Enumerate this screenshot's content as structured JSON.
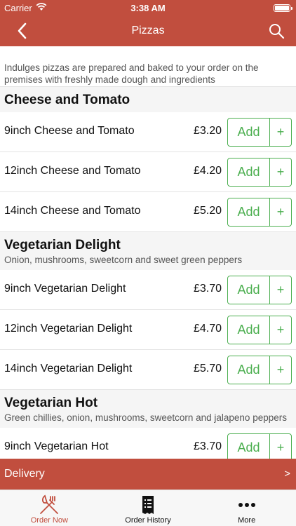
{
  "status": {
    "carrier": "Carrier",
    "time": "3:38 AM"
  },
  "navbar": {
    "title": "Pizzas",
    "back_icon": "chevron-left-icon",
    "search_icon": "search-icon"
  },
  "intro": "Indulges pizzas are prepared and baked to your order on the premises with freshly made dough and ingredients",
  "add_label": "Add",
  "plus_label": "+",
  "sections": [
    {
      "title": "Cheese and Tomato",
      "description": "",
      "items": [
        {
          "name": "9inch Cheese and Tomato",
          "price": "£3.20"
        },
        {
          "name": "12inch Cheese and Tomato",
          "price": "£4.20"
        },
        {
          "name": "14inch Cheese and Tomato",
          "price": "£5.20"
        }
      ]
    },
    {
      "title": "Vegetarian Delight",
      "description": "Onion, mushrooms, sweetcorn and sweet green peppers",
      "items": [
        {
          "name": "9inch Vegetarian Delight",
          "price": "£3.70"
        },
        {
          "name": "12inch Vegetarian Delight",
          "price": "£4.70"
        },
        {
          "name": "14inch Vegetarian Delight",
          "price": "£5.70"
        }
      ]
    },
    {
      "title": "Vegetarian Hot",
      "description": "Green chillies, onion, mushrooms, sweetcorn and jalapeno peppers",
      "items": [
        {
          "name": "9inch Vegetarian Hot",
          "price": "£3.70"
        }
      ]
    }
  ],
  "delivery": {
    "label": "Delivery",
    "arrow": ">"
  },
  "tabs": [
    {
      "label": "Order Now",
      "icon": "fork-knife-icon",
      "active": true
    },
    {
      "label": "Order History",
      "icon": "receipt-icon",
      "active": false
    },
    {
      "label": "More",
      "icon": "more-dots-icon",
      "active": false
    }
  ],
  "colors": {
    "brand": "#c14e3e",
    "accent_green": "#4caf50"
  }
}
